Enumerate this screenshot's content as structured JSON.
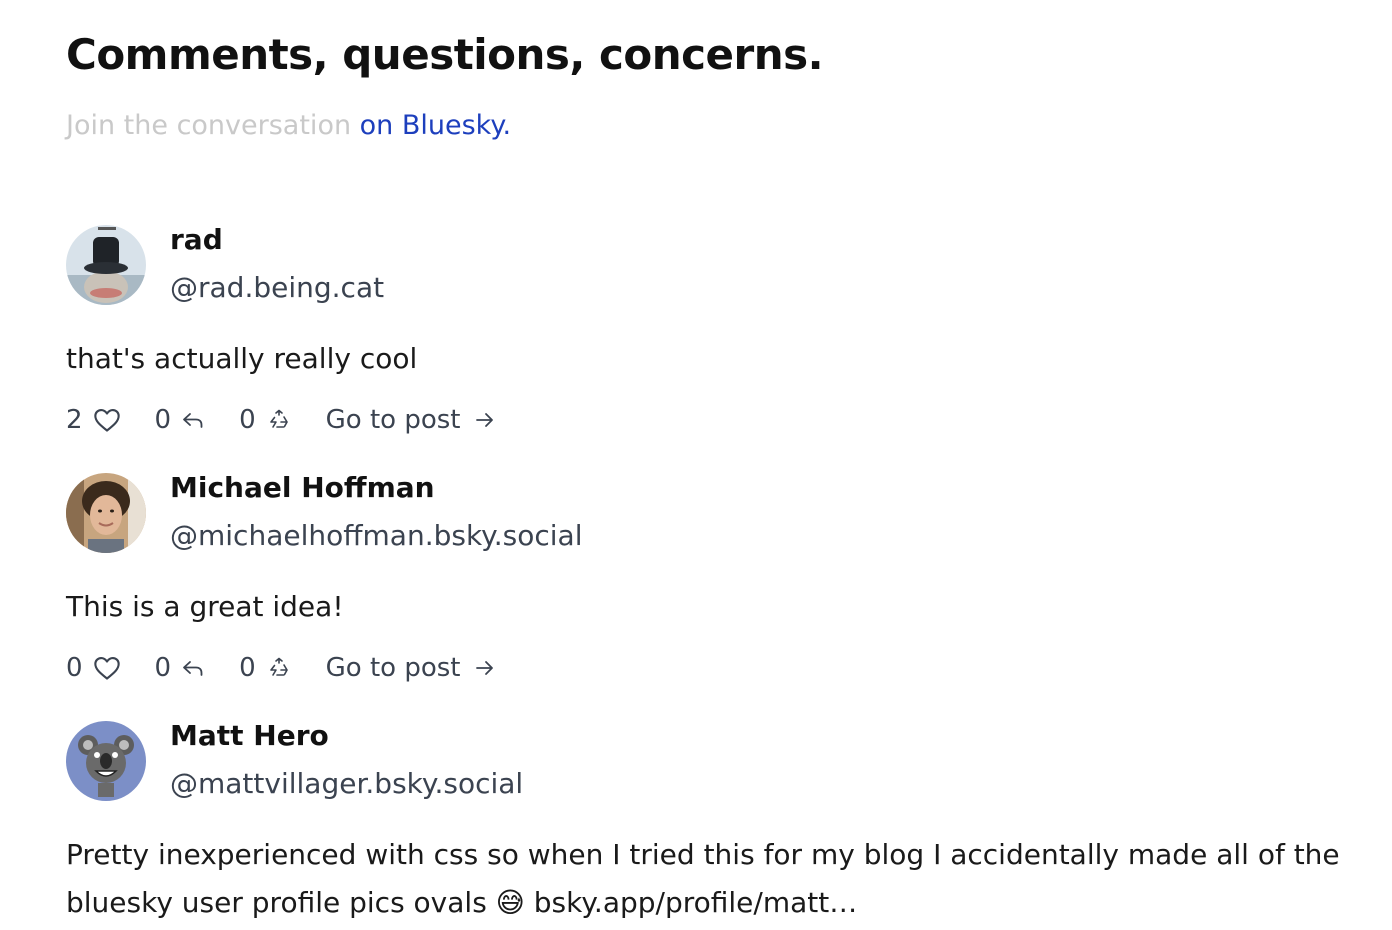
{
  "header": {
    "title": "Comments, questions, concerns.",
    "subtitle_prefix": "Join the conversation ",
    "subtitle_link": "on Bluesky."
  },
  "colors": {
    "link": "#1d3fbd",
    "muted": "#c9c9c9",
    "secondary_text": "#3b4350"
  },
  "comments": [
    {
      "name": "rad",
      "handle": "@rad.being.cat",
      "text": "that's actually really cool",
      "likes": "2",
      "replies": "0",
      "reposts": "0",
      "goto_label": "Go to post",
      "avatar_icon": "cat-in-top-hat-avatar"
    },
    {
      "name": "Michael Hoffman",
      "handle": "@michaelhoffman.bsky.social",
      "text": "This is a great idea!",
      "likes": "0",
      "replies": "0",
      "reposts": "0",
      "goto_label": "Go to post",
      "avatar_icon": "person-portrait-avatar"
    },
    {
      "name": "Matt Hero",
      "handle": "@mattvillager.bsky.social",
      "text": "Pretty inexperienced with css so when I tried this for my blog I accidentally made all of the bluesky user profile pics ovals 😅 bsky.app/profile/matt…",
      "avatar_icon": "cartoon-koala-avatar"
    }
  ]
}
